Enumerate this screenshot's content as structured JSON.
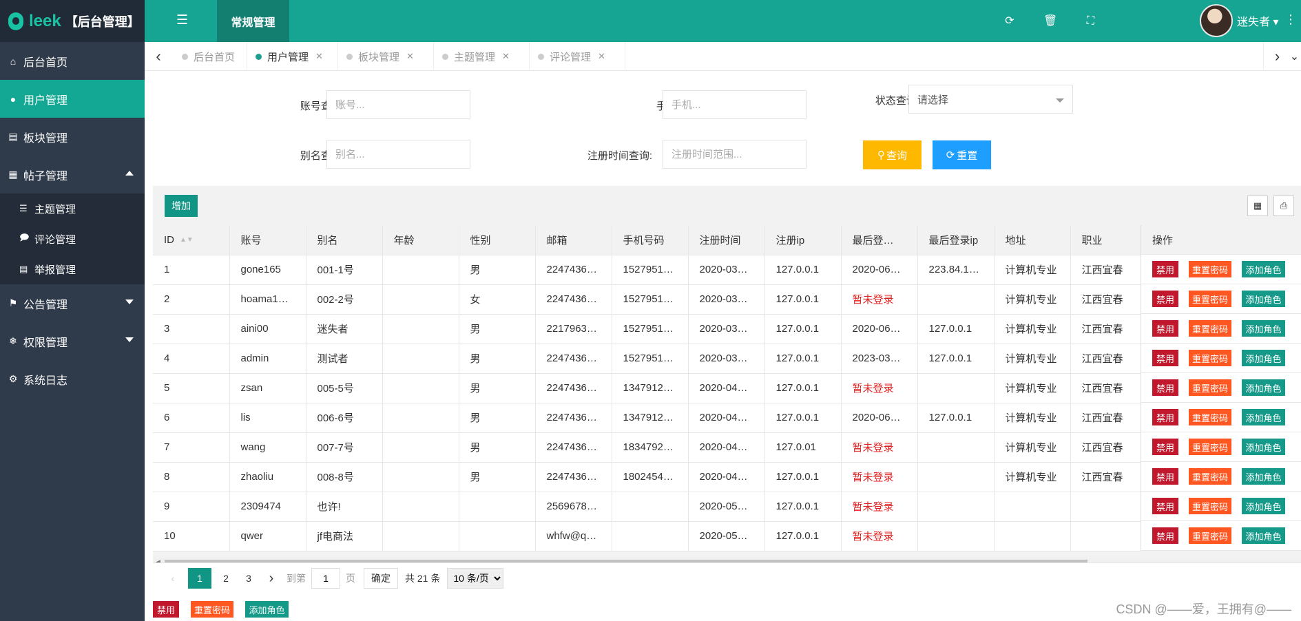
{
  "app": {
    "logo_word": "leek",
    "title": "【后台管理】"
  },
  "topbar": {
    "nav_item": "常规管理",
    "user_name": "迷失者 ▾"
  },
  "sidebar": {
    "items": [
      {
        "label": "后台首页",
        "icon": "home-icon"
      },
      {
        "label": "用户管理",
        "icon": "user-icon"
      },
      {
        "label": "板块管理",
        "icon": "file-icon"
      },
      {
        "label": "帖子管理",
        "icon": "calendar-icon"
      },
      {
        "label": "公告管理",
        "icon": "flag-icon"
      },
      {
        "label": "权限管理",
        "icon": "snowflake-icon"
      },
      {
        "label": "系统日志",
        "icon": "gears-icon"
      }
    ],
    "sub_items": [
      {
        "label": "主题管理",
        "icon": "list-icon"
      },
      {
        "label": "评论管理",
        "icon": "comment-icon"
      },
      {
        "label": "举报管理",
        "icon": "table-icon"
      }
    ]
  },
  "tabs": [
    "后台首页",
    "用户管理",
    "板块管理",
    "主题管理",
    "评论管理"
  ],
  "search": {
    "account_label": "账号查询:",
    "account_placeholder": "账号...",
    "phone_label": "手机查询:",
    "phone_placeholder": "手机...",
    "status_label": "状态查询:",
    "status_value": "请选择",
    "alias_label": "别名查询:",
    "alias_placeholder": "别名...",
    "regtime_label": "注册时间查询:",
    "regtime_placeholder": "注册时间范围...",
    "query_button": "查询",
    "reset_button": "重置"
  },
  "toolbar": {
    "add_button": "增加"
  },
  "table": {
    "headers": [
      "ID",
      "账号",
      "别名",
      "年龄",
      "性别",
      "邮箱",
      "手机号码",
      "注册时间",
      "注册ip",
      "最后登…",
      "最后登录ip",
      "地址",
      "职业"
    ],
    "ops_header": "操作",
    "rows": [
      [
        "1",
        "gone165",
        "001-1号",
        "",
        "男",
        "2247436…",
        "1527951…",
        "2020-03…",
        "127.0.0.1",
        "2020-06…",
        "223.84.1…",
        "计算机专业",
        "江西宜春"
      ],
      [
        "2",
        "hoama1…",
        "002-2号",
        "",
        "女",
        "2247436…",
        "1527951…",
        "2020-03…",
        "127.0.0.1",
        "暂未登录",
        "",
        "计算机专业",
        "江西宜春"
      ],
      [
        "3",
        "aini00",
        "迷失者",
        "",
        "男",
        "2217963…",
        "1527951…",
        "2020-03…",
        "127.0.0.1",
        "2020-06…",
        "127.0.0.1",
        "计算机专业",
        "江西宜春"
      ],
      [
        "4",
        "admin",
        "测试者",
        "",
        "男",
        "2247436…",
        "1527951…",
        "2020-03…",
        "127.0.0.1",
        "2023-03…",
        "127.0.0.1",
        "计算机专业",
        "江西宜春"
      ],
      [
        "5",
        "zsan",
        "005-5号",
        "",
        "男",
        "2247436…",
        "1347912…",
        "2020-04…",
        "127.0.0.1",
        "暂未登录",
        "",
        "计算机专业",
        "江西宜春"
      ],
      [
        "6",
        "lis",
        "006-6号",
        "",
        "男",
        "2247436…",
        "1347912…",
        "2020-04…",
        "127.0.0.1",
        "2020-06…",
        "127.0.0.1",
        "计算机专业",
        "江西宜春"
      ],
      [
        "7",
        "wang",
        "007-7号",
        "",
        "男",
        "2247436…",
        "1834792…",
        "2020-04…",
        "127.0.01",
        "暂未登录",
        "",
        "计算机专业",
        "江西宜春"
      ],
      [
        "8",
        "zhaoliu",
        "008-8号",
        "",
        "男",
        "2247436…",
        "1802454…",
        "2020-04…",
        "127.0.0.1",
        "暂未登录",
        "",
        "计算机专业",
        "江西宜春"
      ],
      [
        "9",
        "2309474",
        "也许!",
        "",
        "",
        "2569678…",
        "",
        "2020-05…",
        "127.0.0.1",
        "暂未登录",
        "",
        "",
        ""
      ],
      [
        "10",
        "qwer",
        "jf电商法",
        "",
        "",
        "whfw@q…",
        "",
        "2020-05…",
        "127.0.0.1",
        "暂未登录",
        "",
        "",
        ""
      ]
    ],
    "op_buttons": {
      "disable": "禁用",
      "reset_pwd": "重置密码",
      "add_role": "添加角色"
    },
    "not_logged_text": "暂未登录"
  },
  "pager": {
    "pages": [
      "1",
      "2",
      "3"
    ],
    "current": "1",
    "goto_label": "到第",
    "page_input": "1",
    "page_unit": "页",
    "confirm": "确定",
    "total": "共 21 条",
    "page_size": "10 条/页"
  },
  "bottom_buttons": {
    "disable": "禁用",
    "reset_pwd": "重置密码",
    "add_role": "添加角色"
  },
  "watermark": "CSDN @——爱，王拥有@——",
  "colors": {
    "primary": "#16a592",
    "sidebar": "#2f3a4a",
    "danger": "#c2182e",
    "warn": "#ff5722",
    "query": "#ffb800",
    "reset": "#1e9fff"
  }
}
